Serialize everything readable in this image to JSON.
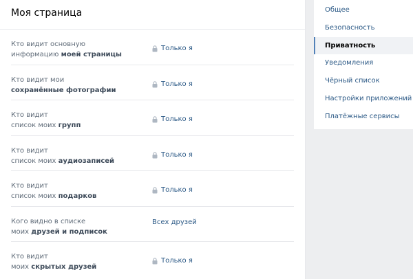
{
  "header": {
    "title": "Моя страница"
  },
  "rows": [
    {
      "pre": "Кто видит основную",
      "line2_plain": "информацию ",
      "line2_bold": "моей страницы",
      "value": "Только я",
      "lock": true
    },
    {
      "pre": "Кто видит мои",
      "line2_plain": "",
      "line2_bold": "сохранённые фотографии",
      "value": "Только я",
      "lock": true
    },
    {
      "pre": "Кто видит",
      "line2_plain": "список моих ",
      "line2_bold": "групп",
      "value": "Только я",
      "lock": true
    },
    {
      "pre": "Кто видит",
      "line2_plain": "список моих ",
      "line2_bold": "аудиозаписей",
      "value": "Только я",
      "lock": true
    },
    {
      "pre": "Кто видит",
      "line2_plain": "список моих ",
      "line2_bold": "подарков",
      "value": "Только я",
      "lock": true
    },
    {
      "pre": "Кого видно в списке",
      "line2_plain": "моих ",
      "line2_bold": "друзей и подписок",
      "value": "Всех друзей",
      "lock": false
    },
    {
      "pre": "Кто видит",
      "line2_plain": "моих ",
      "line2_bold": "скрытых друзей",
      "value": "Только я",
      "lock": true
    }
  ],
  "sidebar": {
    "items": [
      {
        "label": "Общее"
      },
      {
        "label": "Безопасность"
      },
      {
        "label": "Приватность"
      },
      {
        "label": "Уведомления"
      },
      {
        "label": "Чёрный список"
      },
      {
        "label": "Настройки приложений"
      },
      {
        "label": "Платёжные сервисы"
      }
    ],
    "active_index": 2
  },
  "colors": {
    "link": "#2a5885",
    "accent": "#5181b8",
    "background": "#edeef0"
  },
  "icons": {
    "lock": "lock-icon"
  }
}
